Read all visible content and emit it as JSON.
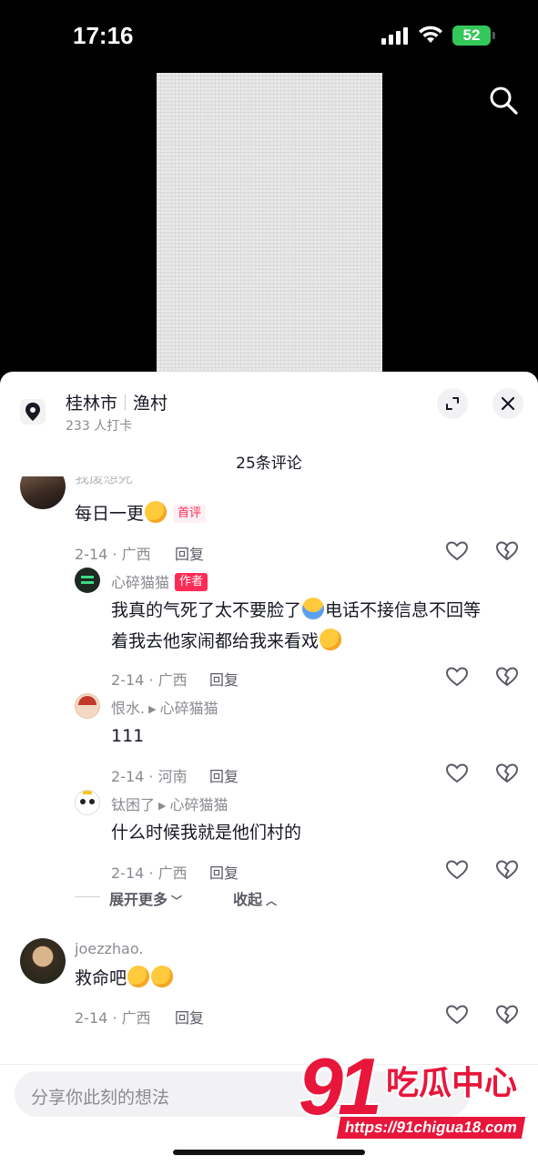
{
  "status_bar": {
    "time": "17:16",
    "battery": "52"
  },
  "location": {
    "title_city": "桂林市",
    "title_place": "渔村",
    "checkins": "233 人打卡"
  },
  "comment_count": "25条评论",
  "comments": [
    {
      "username": "我废想死",
      "text": "每日一更",
      "tag": "首评",
      "meta": "2-14 · 广西",
      "reply": "回复",
      "replies": [
        {
          "username": "心碎猫猫",
          "tag": "作者",
          "text_line1": "我真的气死了太不要脸了",
          "text_line1b": "电话不接信息不回等",
          "text_line2": "着我去他家闹都给我来看戏",
          "meta": "2-14 · 广西",
          "reply": "回复"
        },
        {
          "username": "恨水.",
          "reply_to": "心碎猫猫",
          "text": "111",
          "meta": "2-14 · 河南",
          "reply": "回复"
        },
        {
          "username": "钛困了",
          "reply_to": "心碎猫猫",
          "text": "什么时候我就是他们村的",
          "meta": "2-14 · 广西",
          "reply": "回复"
        }
      ],
      "expand_more": "展开更多",
      "collapse": "收起"
    },
    {
      "username": "joezzhao.",
      "text": "救命吧",
      "meta": "2-14 · 广西",
      "reply": "回复"
    }
  ],
  "input": {
    "placeholder": "分享你此刻的想法"
  },
  "watermark": {
    "logo_number": "91",
    "logo_text": "吃瓜中心",
    "url": "https://91chigua18.com"
  },
  "colors": {
    "accent": "#fe2c55",
    "battery": "#34c759",
    "watermark": "#e8163b"
  }
}
